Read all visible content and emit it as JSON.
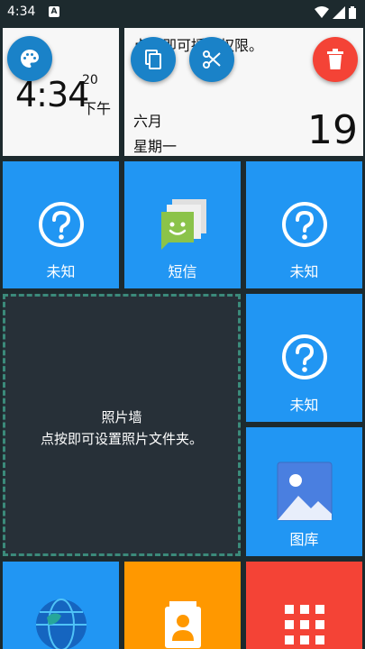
{
  "status_bar": {
    "time": "4:34",
    "notification_badge": "A"
  },
  "clock_tile": {
    "hours_minutes": "4:34",
    "seconds": "20",
    "ampm": "下午"
  },
  "calendar_tile": {
    "notice": "点按即可授予权限。",
    "month": "六月",
    "weekday": "星期一",
    "day": "19"
  },
  "tiles": {
    "unknown_1": "未知",
    "sms": "短信",
    "unknown_2": "未知",
    "unknown_3": "未知",
    "gallery": "图库"
  },
  "photo_wall": {
    "title": "照片墙",
    "hint": "点按即可设置照片文件夹。"
  },
  "colors": {
    "tile_blue": "#2196f3",
    "tile_orange": "#ff9800",
    "tile_red": "#f44336",
    "fab_blue": "#1a82c8",
    "fab_red": "#f44336",
    "background": "#1d2a2e"
  }
}
